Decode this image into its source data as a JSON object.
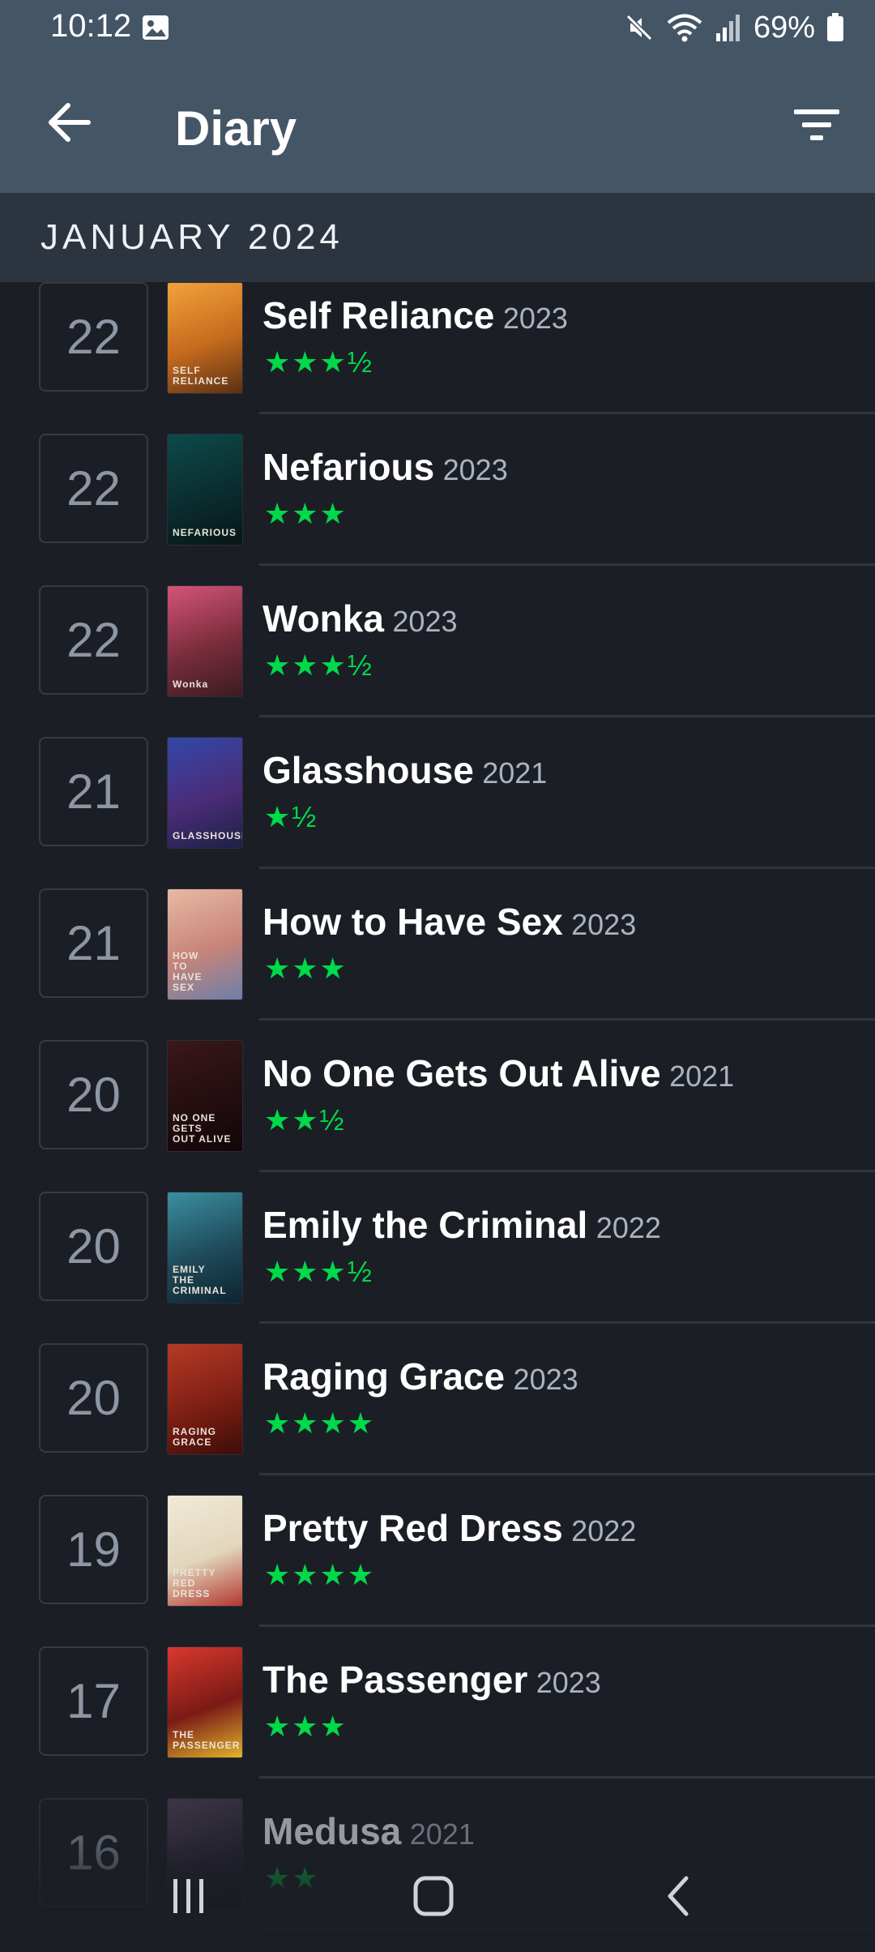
{
  "status_bar": {
    "time": "10:12",
    "battery_percent": "69%",
    "icons": [
      "gallery-icon",
      "mute-icon",
      "wifi-icon",
      "signal-icon",
      "battery-icon"
    ]
  },
  "app_bar": {
    "title": "Diary",
    "back_icon": "arrow-left-icon",
    "filter_icon": "filter-icon"
  },
  "month_header": "JANUARY 2024",
  "colors": {
    "app_bar": "#445566",
    "month_header": "#2c3440",
    "background": "#1b1e25",
    "star_green": "#00d94a"
  },
  "entries": [
    {
      "day": "22",
      "title": "Self Reliance",
      "year": "2023",
      "stars": "★★★½",
      "rating": 3.5
    },
    {
      "day": "22",
      "title": "Nefarious",
      "year": "2023",
      "stars": "★★★",
      "rating": 3
    },
    {
      "day": "22",
      "title": "Wonka",
      "year": "2023",
      "stars": "★★★½",
      "rating": 3.5
    },
    {
      "day": "21",
      "title": "Glasshouse",
      "year": "2021",
      "stars": "★½",
      "rating": 1.5
    },
    {
      "day": "21",
      "title": "How to Have Sex",
      "year": "2023",
      "stars": "★★★",
      "rating": 3
    },
    {
      "day": "20",
      "title": "No One Gets Out Alive",
      "year": "2021",
      "stars": "★★½",
      "rating": 2.5
    },
    {
      "day": "20",
      "title": "Emily the Criminal",
      "year": "2022",
      "stars": "★★★½",
      "rating": 3.5
    },
    {
      "day": "20",
      "title": "Raging Grace",
      "year": "2023",
      "stars": "★★★★",
      "rating": 4
    },
    {
      "day": "19",
      "title": "Pretty Red Dress",
      "year": "2022",
      "stars": "★★★★",
      "rating": 4
    },
    {
      "day": "17",
      "title": "The Passenger",
      "year": "2023",
      "stars": "★★★",
      "rating": 3
    },
    {
      "day": "16",
      "title": "Medusa",
      "year": "2021",
      "stars": "★★",
      "rating": 2
    }
  ],
  "posters": [
    {
      "text": "SELF\nRELIANCE",
      "colors": [
        "#f2a23a",
        "#c46a1d",
        "#5a3014"
      ]
    },
    {
      "text": "NEFARIOUS",
      "colors": [
        "#0d4a4a",
        "#0b2d2f",
        "#061617"
      ]
    },
    {
      "text": "Wonka",
      "colors": [
        "#d4547a",
        "#7a2c3c",
        "#3a1c22"
      ]
    },
    {
      "text": "GLASSHOUSE",
      "colors": [
        "#3248a8",
        "#4b2c78",
        "#1c2146"
      ]
    },
    {
      "text": "HOW\nTO\nHAVE\nSEX",
      "colors": [
        "#e8b9a4",
        "#c7847a",
        "#6c7fa8"
      ]
    },
    {
      "text": "NO ONE GETS\nOUT ALIVE",
      "colors": [
        "#3a1818",
        "#240d10",
        "#120608"
      ]
    },
    {
      "text": "EMILY\nTHE\nCRIMINAL",
      "colors": [
        "#3a8fa0",
        "#1f4a5a",
        "#0e2430"
      ]
    },
    {
      "text": "RAGING\nGRACE",
      "colors": [
        "#b63a26",
        "#7e1f14",
        "#3c0d09"
      ]
    },
    {
      "text": "PRETTY\nRED\nDRESS",
      "colors": [
        "#f1ead8",
        "#e2d6bc",
        "#b3362e"
      ]
    },
    {
      "text": "THE\nPASSENGER",
      "colors": [
        "#d8392d",
        "#7b1a16",
        "#e0b52a"
      ]
    },
    {
      "text": "",
      "colors": [
        "#5a4a62",
        "#2a2534",
        "#141219"
      ]
    }
  ],
  "navigation": {
    "recents_icon": "recents-icon",
    "home_icon": "home-icon",
    "back_icon": "nav-back-icon"
  }
}
